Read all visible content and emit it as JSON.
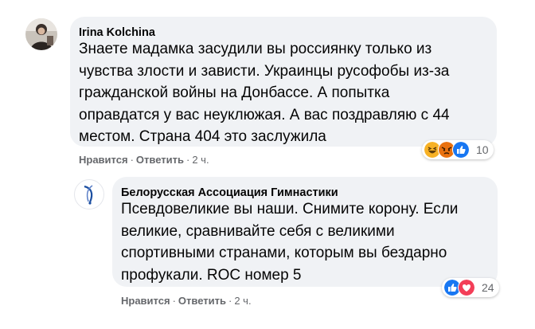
{
  "comments": [
    {
      "author": "Irina Kolchina",
      "lines": [
        "Знаете мадамка засудили вы россиянку только из",
        "чувства злости и зависти. Украинцы русофобы из-за",
        "гражданской войны на Донбассе. А попытка",
        "оправдатся у вас неуклюжая. А вас поздравляю с 44",
        "местом. Страна 404 это заслужила"
      ],
      "like_label": "Нравится",
      "reply_label": "Ответить",
      "separator": "·",
      "time": "2 ч.",
      "reaction_icons": [
        "haha-reaction-icon",
        "angry-reaction-icon",
        "like-reaction-icon"
      ],
      "reaction_count": "10"
    },
    {
      "author": "Белорусская Ассоциация Гимнастики",
      "lines": [
        "Псевдовеликие вы наши. Снимите корону. Если",
        "великие, сравнивайте себя с великими",
        "спортивными странами, которым вы бездарно",
        "профукали. ROC номер 5"
      ],
      "like_label": "Нравится",
      "reply_label": "Ответить",
      "separator": "·",
      "time": "2 ч.",
      "reaction_icons": [
        "like-reaction-icon",
        "love-reaction-icon"
      ],
      "reaction_count": "24"
    }
  ],
  "colors": {
    "bubble": "#f0f2f5",
    "secondary_text": "#65676b",
    "like_blue": "#1877f2",
    "love_red": "#f33e58",
    "haha_yellow": "#f7b125",
    "angry_orange": "#e9710f"
  }
}
